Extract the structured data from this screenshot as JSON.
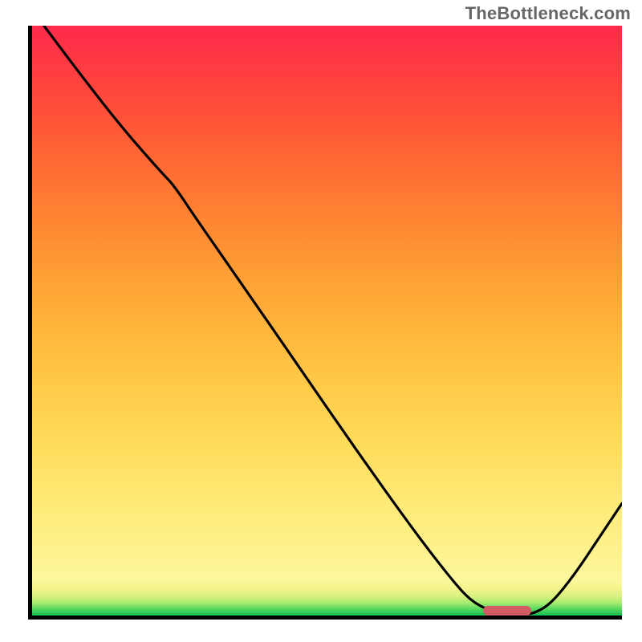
{
  "watermark": "TheBottleneck.com",
  "chart_data": {
    "type": "line",
    "title": "",
    "xlabel": "",
    "ylabel": "",
    "xlim": [
      0,
      100
    ],
    "ylim": [
      0,
      100
    ],
    "series": [
      {
        "name": "bottleneck-curve",
        "x": [
          2,
          8,
          15,
          22,
          24,
          28,
          35,
          45,
          55,
          65,
          72,
          75,
          79,
          83,
          85,
          88,
          92,
          96,
          100
        ],
        "values": [
          100,
          92,
          83,
          75,
          73,
          67,
          57,
          42.5,
          28,
          14,
          5,
          2,
          0.3,
          0.2,
          0.3,
          2,
          7,
          13,
          19
        ]
      }
    ],
    "optimal_zone": {
      "x_start": 76,
      "x_end": 84
    },
    "colors": {
      "curve": "#000000",
      "marker": "#d35b63",
      "gradient_top": "#ff2a4b",
      "gradient_bottom": "#12c251"
    }
  }
}
